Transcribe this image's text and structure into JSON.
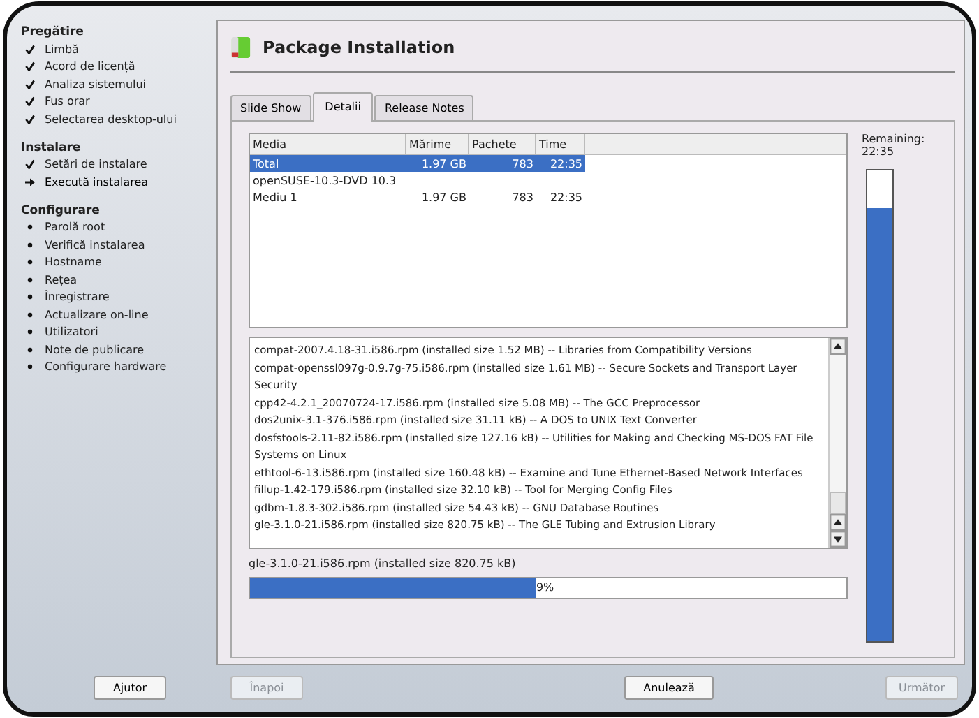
{
  "sidebar": {
    "sections": [
      {
        "title": "Pregătire",
        "items": [
          {
            "label": "Limbă",
            "kind": "done"
          },
          {
            "label": "Acord de licență",
            "kind": "done"
          },
          {
            "label": "Analiza sistemului",
            "kind": "done"
          },
          {
            "label": "Fus orar",
            "kind": "done"
          },
          {
            "label": "Selectarea desktop-ului",
            "kind": "done"
          }
        ]
      },
      {
        "title": "Instalare",
        "items": [
          {
            "label": "Setări de instalare",
            "kind": "done"
          },
          {
            "label": "Execută instalarea",
            "kind": "current"
          }
        ]
      },
      {
        "title": "Configurare",
        "items": [
          {
            "label": "Parolă root",
            "kind": "pending"
          },
          {
            "label": "Verifică instalarea",
            "kind": "pending"
          },
          {
            "label": "Hostname",
            "kind": "pending"
          },
          {
            "label": "Rețea",
            "kind": "pending"
          },
          {
            "label": "Înregistrare",
            "kind": "pending"
          },
          {
            "label": "Actualizare on-line",
            "kind": "pending"
          },
          {
            "label": "Utilizatori",
            "kind": "pending"
          },
          {
            "label": "Note de publicare",
            "kind": "pending"
          },
          {
            "label": "Configurare hardware",
            "kind": "pending"
          }
        ]
      }
    ]
  },
  "title": "Package Installation",
  "tabs": [
    {
      "label": "Slide Show",
      "selected": false
    },
    {
      "label": "Detalii",
      "selected": true
    },
    {
      "label": "Release Notes",
      "selected": false
    }
  ],
  "media_table": {
    "columns": [
      "Media",
      "Mărime",
      "Pachete",
      "Time"
    ],
    "rows": [
      {
        "cells": [
          "Total",
          "1.97 GB",
          "783",
          "22:35"
        ],
        "selected": true
      },
      {
        "cells": [
          "openSUSE-10.3-DVD 10.3",
          "",
          "",
          ""
        ],
        "selected": false
      },
      {
        "cells": [
          "Mediu 1",
          "1.97 GB",
          "783",
          "22:35"
        ],
        "selected": false
      }
    ]
  },
  "remaining": {
    "label": "Remaining:",
    "time": "22:35",
    "level": 0.92
  },
  "log": [
    "compat-2007.4.18-31.i586.rpm (installed size 1.52 MB) -- Libraries from Compatibility Versions",
    "compat-openssl097g-0.9.7g-75.i586.rpm (installed size 1.61 MB) -- Secure Sockets and Transport Layer Security",
    "cpp42-4.2.1_20070724-17.i586.rpm (installed size 5.08 MB) -- The GCC Preprocessor",
    "dos2unix-3.1-376.i586.rpm (installed size 31.11 kB) -- A DOS to UNIX Text Converter",
    "dosfstools-2.11-82.i586.rpm (installed size 127.16 kB) -- Utilities for Making and Checking MS-DOS FAT File Systems on Linux",
    "ethtool-6-13.i586.rpm (installed size 160.48 kB) -- Examine and Tune Ethernet-Based Network Interfaces",
    "fillup-1.42-179.i586.rpm (installed size 32.10 kB) -- Tool for Merging Config Files",
    "gdbm-1.8.3-302.i586.rpm (installed size 54.43 kB) -- GNU Database Routines",
    "gle-3.1.0-21.i586.rpm (installed size 820.75 kB) -- The GLE Tubing and Extrusion Library"
  ],
  "current": {
    "label": "gle-3.1.0-21.i586.rpm (installed size 820.75 kB)",
    "level": 0.48,
    "text": "9%"
  },
  "buttons": [
    {
      "label": "Ajutor",
      "disabled": false
    },
    {
      "label": "Înapoi",
      "disabled": true
    },
    {
      "label": "Anulează",
      "disabled": false
    },
    {
      "label": "Următor",
      "disabled": true
    }
  ]
}
